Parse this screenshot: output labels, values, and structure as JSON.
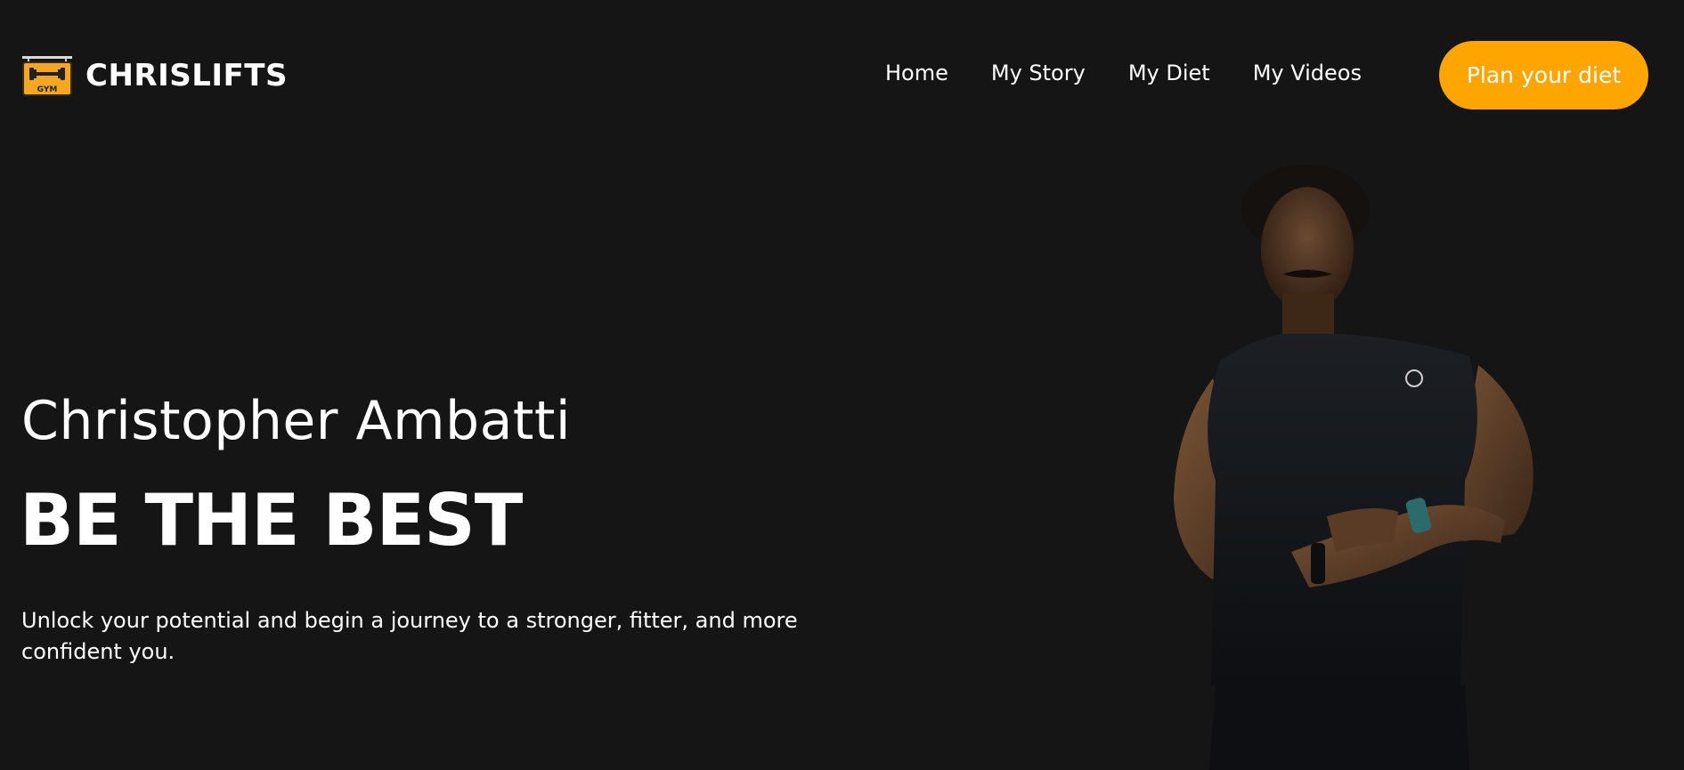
{
  "brand": {
    "name": "CHRISLIFTS",
    "logo_icon": "gym-dumbbell-sign-icon",
    "logo_text": "GYM",
    "logo_color": "#f5a623"
  },
  "nav": {
    "items": [
      {
        "label": "Home"
      },
      {
        "label": "My Story"
      },
      {
        "label": "My Diet"
      },
      {
        "label": "My Videos"
      }
    ]
  },
  "cta": {
    "label": "Plan your diet",
    "color": "#ffa500"
  },
  "hero": {
    "name": "Christopher Ambatti",
    "headline": "BE THE BEST",
    "tagline": "Unlock your potential and begin a journey to a stronger, fitter, and more confident you.",
    "image": "athlete-portrait-photo"
  },
  "theme": {
    "background": "#151515",
    "text": "#ffffff",
    "accent": "#ffa500"
  }
}
